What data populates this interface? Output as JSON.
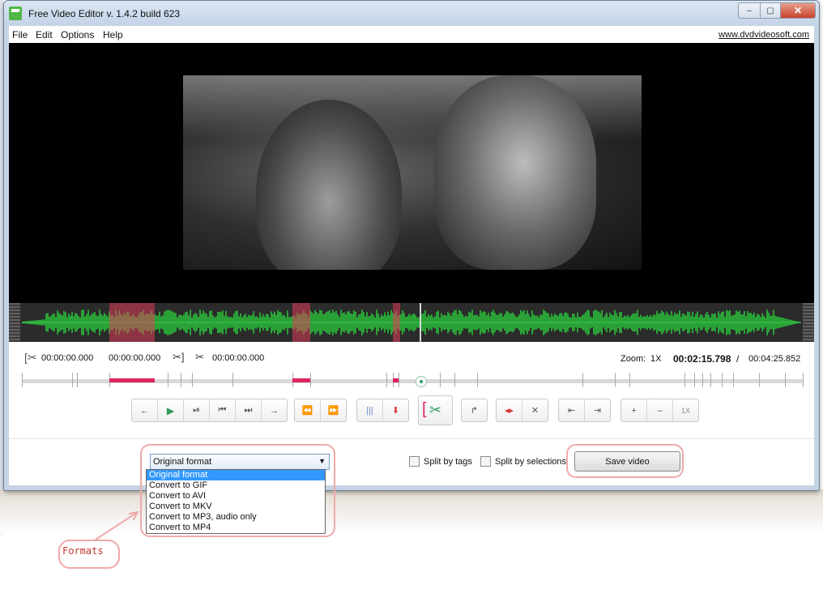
{
  "window": {
    "title": "Free Video Editor v. 1.4.2 build 623",
    "close_glyph": "✕",
    "maximize_glyph": "▢",
    "minimize_glyph": "–"
  },
  "menu": {
    "items": [
      "File",
      "Edit",
      "Options",
      "Help"
    ],
    "website": "www.dvdvideosoft.com"
  },
  "selection": {
    "start": "00:00:00.000",
    "end": "00:00:00.000",
    "cut": "00:00:00.000"
  },
  "zoom": {
    "label": "Zoom:",
    "value": "1X"
  },
  "time": {
    "current": "00:02:15.798",
    "separator": "/",
    "total": "00:04:25.852"
  },
  "controls": {
    "playback": [
      "←",
      "▶",
      "⏯",
      "⏮",
      "⏭",
      "→"
    ],
    "seek": [
      "⏪",
      "⏩"
    ],
    "markers": [
      "|||",
      "⬇"
    ],
    "cut": "✂",
    "rotate": "↱",
    "tag": [
      "◂▸",
      "✕"
    ],
    "jump": [
      "⇤",
      "⇥"
    ],
    "zoom": [
      "+",
      "–",
      "1X"
    ]
  },
  "output": {
    "format_selected": "Original format",
    "format_options": [
      "Original format",
      "Convert to GIF",
      "Convert to AVI",
      "Convert to MKV",
      "Convert to MP3, audio only",
      "Convert to MP4"
    ],
    "split_by_tags": "Split by tags",
    "split_by_selections": "Split by selections",
    "save_label": "Save video"
  },
  "annotation": {
    "label": "Formats"
  },
  "colors": {
    "selection": "#e0245e",
    "waveform": "#2bbf3a",
    "accent": "#2c9a5a"
  }
}
